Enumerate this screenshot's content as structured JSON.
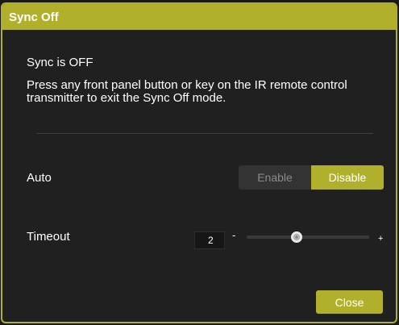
{
  "dialog": {
    "title": "Sync Off",
    "status": "Sync is OFF",
    "instructions": "Press any front panel button or key on the IR remote control transmitter to exit the Sync Off mode."
  },
  "auto": {
    "label": "Auto",
    "options": [
      "Enable",
      "Disable"
    ],
    "selected": "Disable"
  },
  "timeout": {
    "label": "Timeout",
    "value": "2",
    "minus": "-",
    "plus": "+",
    "slider_fraction": 0.41
  },
  "footer": {
    "close_label": "Close"
  },
  "colors": {
    "accent": "#b0b02c",
    "background": "#202020"
  }
}
